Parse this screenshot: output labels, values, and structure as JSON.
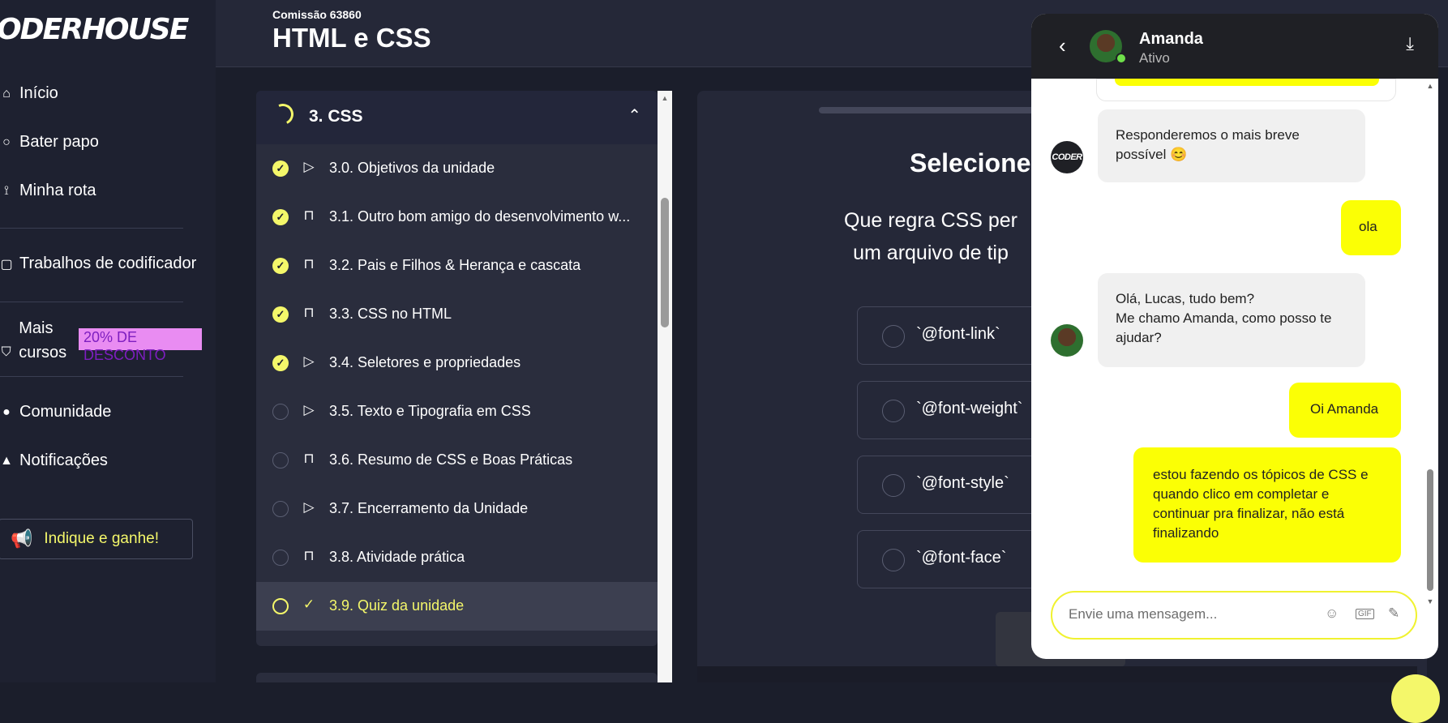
{
  "brand": {
    "logo": "ODERHOUSE"
  },
  "sidebar": {
    "items": [
      {
        "label": "Início",
        "icon": "home-icon"
      },
      {
        "label": "Bater papo",
        "icon": "chat-icon"
      },
      {
        "label": "Minha rota",
        "icon": "route-icon"
      },
      {
        "label": "Trabalhos de codificador",
        "icon": "briefcase-icon"
      },
      {
        "label": "Mais cursos",
        "icon": "cart-icon",
        "badge": "20% DE DESCONTO"
      },
      {
        "label": "Comunidade",
        "icon": "community-icon"
      },
      {
        "label": "Notificações",
        "icon": "bell-icon"
      }
    ],
    "cta": {
      "label": "Indique e ganhe!",
      "icon": "megaphone-icon"
    }
  },
  "header": {
    "commission": "Comissão 63860",
    "title": "HTML e CSS"
  },
  "unit": {
    "title": "3. CSS",
    "lessons": [
      {
        "label": "3.0. Objetivos da unidade",
        "status": "done",
        "type": "play-icon"
      },
      {
        "label": "3.1. Outro bom amigo do desenvolvimento w...",
        "status": "done",
        "type": "book-icon"
      },
      {
        "label": "3.2. Pais e Filhos & Herança e cascata",
        "status": "done",
        "type": "book-icon"
      },
      {
        "label": "3.3. CSS no HTML",
        "status": "done",
        "type": "book-icon"
      },
      {
        "label": "3.4. Seletores e propriedades",
        "status": "done",
        "type": "play-icon"
      },
      {
        "label": "3.5. Texto e Tipografia em CSS",
        "status": "todo",
        "type": "play-icon"
      },
      {
        "label": "3.6. Resumo de CSS e Boas Práticas",
        "status": "todo",
        "type": "book-icon"
      },
      {
        "label": "3.7. Encerramento da Unidade",
        "status": "todo",
        "type": "play-icon"
      },
      {
        "label": "3.8. Atividade prática",
        "status": "todo",
        "type": "book-icon"
      },
      {
        "label": "3.9. Quiz da unidade",
        "status": "current",
        "type": "quiz-icon"
      }
    ]
  },
  "quiz": {
    "heading": "Selecione a",
    "question": "Que regra CSS per um arquivo de tip",
    "options": [
      "`@font-link`",
      "`@font-weight`",
      "`@font-style`",
      "`@font-face`"
    ]
  },
  "chat": {
    "contact_name": "Amanda",
    "contact_status": "Ativo",
    "messages": [
      {
        "dir": "in",
        "sender": "coder",
        "text": "Responderemos o mais breve possível 😊"
      },
      {
        "dir": "out",
        "text": "ola"
      },
      {
        "dir": "in",
        "sender": "amanda",
        "text": "Olá, Lucas, tudo bem?\nMe chamo Amanda, como posso te ajudar?"
      },
      {
        "dir": "out",
        "text": "Oi Amanda"
      },
      {
        "dir": "out",
        "text": "estou fazendo os tópicos de CSS e quando clico em completar e continuar pra finalizar, não está finalizando"
      }
    ],
    "input_placeholder": "Envie uma mensagem...",
    "coder_avatar_text": "CODER"
  },
  "colors": {
    "accent": "#f4f76a",
    "chat_bubble_out": "#fbff05",
    "bg": "#1b1e2b"
  }
}
